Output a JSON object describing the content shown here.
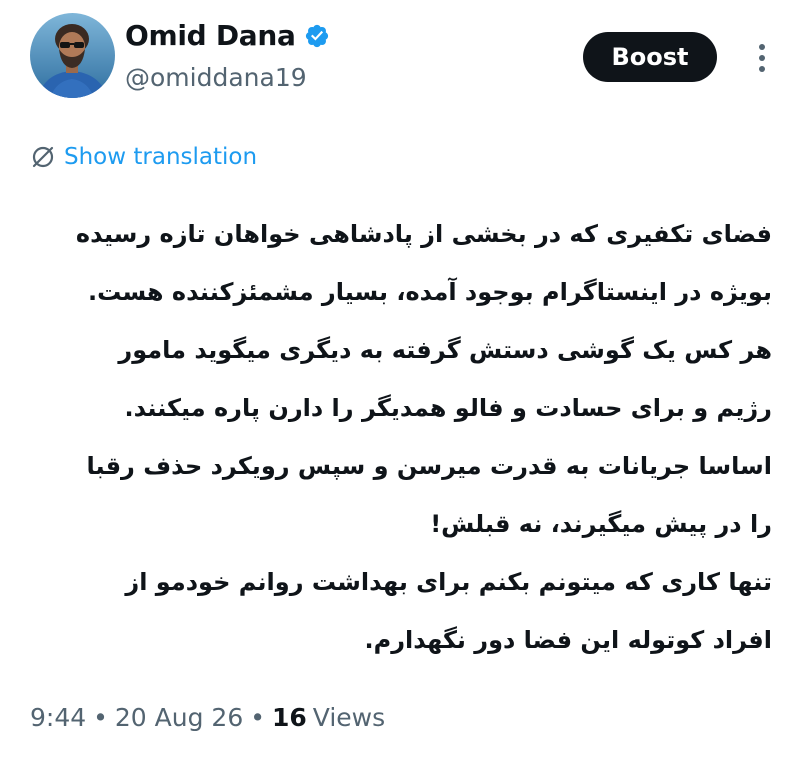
{
  "author": {
    "display_name": "Omid Dana",
    "handle": "@omiddana19",
    "verified": true,
    "verified_color": "#1d9bf0"
  },
  "actions": {
    "boost_label": "Boost",
    "more_icon": "more-vertical-icon"
  },
  "translation": {
    "label": "Show translation",
    "icon": "translate-icon",
    "color": "#1d9bf0"
  },
  "tweet": {
    "lines": [
      "فضای تکفیری که در بخشی از پادشاهی خواهان تازه رسیده",
      "بویژه در اینستاگرام بوجود آمده، بسیار مشمئزکننده هست.",
      "هر کس یک گوشی دستش گرفته به دیگری میگوید مامور",
      "رژیم و برای حسادت و فالو همدیگر را دارن پاره میکنند.",
      "اساسا جریانات به قدرت میرسن و سپس رویکرد حذف رقبا",
      "را در پیش میگیرند، نه قبلش!",
      "تنها کاری که میتونم بکنم برای بهداشت روانم خودمو از",
      "افراد کوتوله این فضا دور نگهدارم."
    ]
  },
  "meta": {
    "time": "9:44",
    "separator": "•",
    "date": "20 Aug 26",
    "views_count": "16",
    "views_label": "Views"
  }
}
